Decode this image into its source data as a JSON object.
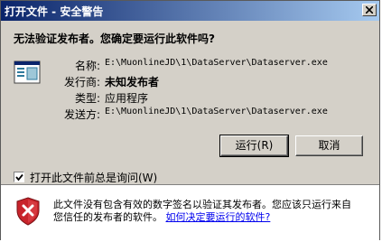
{
  "window": {
    "title": "打开文件 - 安全警告"
  },
  "dialog": {
    "question": "无法验证发布者。您确定要运行此软件吗?",
    "fields": [
      {
        "label": "名称:",
        "value": "E:\\MuonlineJD\\1\\DataServer\\Dataserver.exe",
        "style": "mono"
      },
      {
        "label": "发行商:",
        "value": "未知发布者",
        "style": "bold"
      },
      {
        "label": "类型:",
        "value": "应用程序",
        "style": "normal"
      },
      {
        "label": "发送方:",
        "value": "E:\\MuonlineJD\\1\\DataServer\\Dataserver.exe",
        "style": "mono"
      }
    ],
    "run_button": "运行(R)",
    "cancel_button": "取消",
    "checkbox": {
      "label": "打开此文件前总是询问(W)",
      "checked": true
    }
  },
  "footer": {
    "warning_text": "此文件没有包含有效的数字签名以验证其发布者。您应该只运行来自您信任的发布者的软件。",
    "link_text": "如何决定要运行的软件?"
  },
  "colors": {
    "titlebar_start": "#0a246a",
    "titlebar_end": "#a6caf0",
    "dialog_bg": "#d4d0c8",
    "link": "#0000ee"
  },
  "icons": {
    "app": "application-icon",
    "shield": "shield-error-icon",
    "close": "close-icon"
  }
}
